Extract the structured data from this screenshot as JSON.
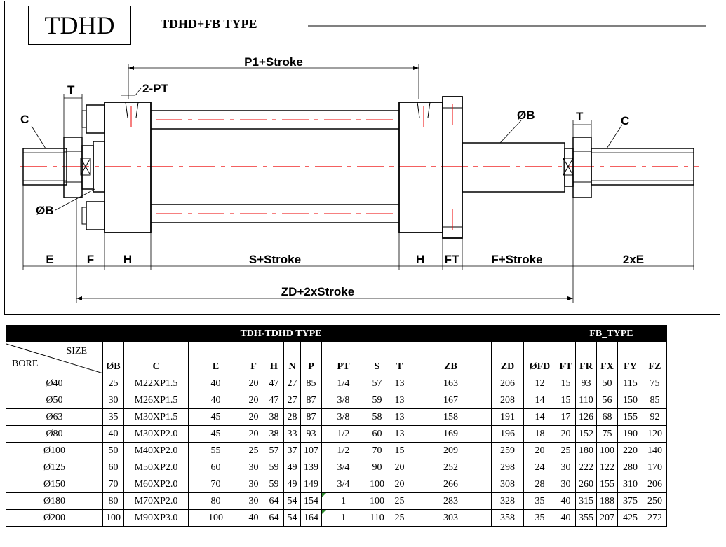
{
  "header": {
    "model": "TDHD",
    "type_title": "TDHD+FB  TYPE"
  },
  "drawing_labels": {
    "p1_stroke": "P1+Stroke",
    "two_pt": "2-PT",
    "t_left": "T",
    "c_left": "C",
    "ob_left": "ØB",
    "ob_right": "ØB",
    "t_right": "T",
    "c_right": "C",
    "e": "E",
    "f": "F",
    "h_left": "H",
    "s_stroke": "S+Stroke",
    "h_right": "H",
    "ft": "FT",
    "f_stroke": "F+Stroke",
    "two_e": "2xE",
    "zd_stroke": "ZD+2xStroke"
  },
  "table": {
    "group_main": "TDH-TDHD TYPE",
    "group_fb": "FB_TYPE",
    "size_label": "SIZE",
    "bore_label": "BORE",
    "columns": [
      "ØB",
      "C",
      "E",
      "F",
      "H",
      "N",
      "P",
      "PT",
      "S",
      "T",
      "ZB",
      "ZD",
      "ØFD",
      "FT",
      "FR",
      "FX",
      "FY",
      "FZ"
    ],
    "rows": [
      {
        "bore": "Ø40",
        "cells": [
          "25",
          "M22XP1.5",
          "40",
          "20",
          "47",
          "27",
          "85",
          "1/4",
          "57",
          "13",
          "163",
          "206",
          "12",
          "15",
          "93",
          "50",
          "115",
          "75"
        ]
      },
      {
        "bore": "Ø50",
        "cells": [
          "30",
          "M26XP1.5",
          "40",
          "20",
          "47",
          "27",
          "87",
          "3/8",
          "59",
          "13",
          "167",
          "208",
          "14",
          "15",
          "110",
          "56",
          "150",
          "85"
        ]
      },
      {
        "bore": "Ø63",
        "cells": [
          "35",
          "M30XP1.5",
          "45",
          "20",
          "38",
          "28",
          "87",
          "3/8",
          "58",
          "13",
          "158",
          "191",
          "14",
          "17",
          "126",
          "68",
          "155",
          "92"
        ]
      },
      {
        "bore": "Ø80",
        "cells": [
          "40",
          "M30XP2.0",
          "45",
          "20",
          "38",
          "33",
          "93",
          "1/2",
          "60",
          "13",
          "169",
          "196",
          "18",
          "20",
          "152",
          "75",
          "190",
          "120"
        ]
      },
      {
        "bore": "Ø100",
        "cells": [
          "50",
          "M40XP2.0",
          "55",
          "25",
          "57",
          "37",
          "107",
          "1/2",
          "70",
          "15",
          "209",
          "259",
          "20",
          "25",
          "180",
          "100",
          "220",
          "140"
        ]
      },
      {
        "bore": "Ø125",
        "cells": [
          "60",
          "M50XP2.0",
          "60",
          "30",
          "59",
          "49",
          "139",
          "3/4",
          "90",
          "20",
          "252",
          "298",
          "24",
          "30",
          "222",
          "122",
          "280",
          "170"
        ]
      },
      {
        "bore": "Ø150",
        "cells": [
          "70",
          "M60XP2.0",
          "70",
          "30",
          "59",
          "49",
          "149",
          "3/4",
          "100",
          "20",
          "266",
          "308",
          "28",
          "30",
          "260",
          "155",
          "310",
          "206"
        ]
      },
      {
        "bore": "Ø180",
        "cells": [
          "80",
          "M70XP2.0",
          "80",
          "30",
          "64",
          "54",
          "154",
          "1",
          "100",
          "25",
          "283",
          "328",
          "35",
          "40",
          "315",
          "188",
          "375",
          "250"
        ]
      },
      {
        "bore": "Ø200",
        "cells": [
          "100",
          "M90XP3.0",
          "100",
          "40",
          "64",
          "54",
          "164",
          "1",
          "110",
          "25",
          "303",
          "358",
          "35",
          "40",
          "355",
          "207",
          "425",
          "272"
        ]
      }
    ]
  }
}
